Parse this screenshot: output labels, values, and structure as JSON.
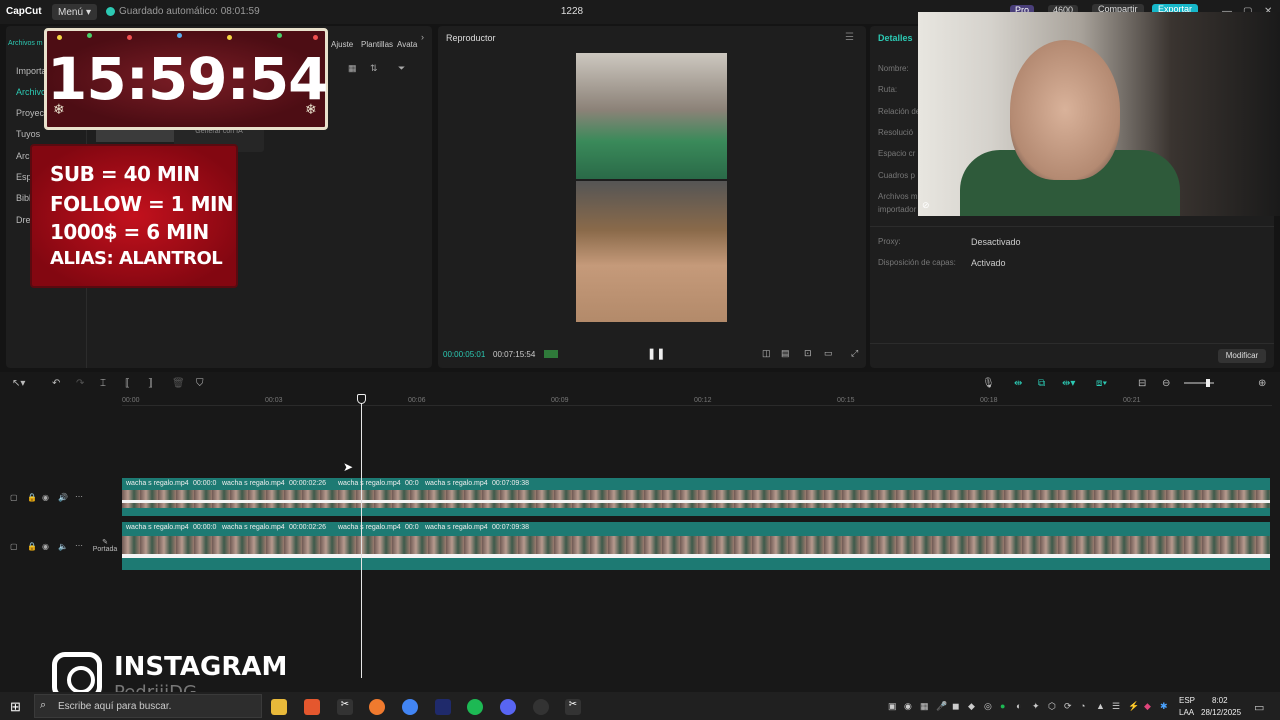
{
  "topbar": {
    "logo": "CapCut",
    "menu_label": "Menú",
    "autosave": "Guardado automático: 08:01:59",
    "project_title": "1228",
    "pro": "Pro",
    "credits": "4600",
    "share": "Compartir",
    "export": "Exportar"
  },
  "media": {
    "top_tab": "Archivos m",
    "sidebar": [
      "Importa",
      "Archivos",
      "Proyect",
      "Tuyos",
      "Arch",
      "Esp",
      "Bibl",
      "Drea"
    ],
    "tools": [
      "Ajuste",
      "Plantillas",
      "Avata"
    ],
    "ai_button": "Generar con IA"
  },
  "overlay": {
    "timer": "15:59:54",
    "rules": [
      "SUB = 40 MIN",
      "FOLLOW = 1 MIN",
      "1000$ = 6 MIN",
      "ALIAS: ALANTROL"
    ],
    "instagram_label": "INSTAGRAM",
    "instagram_user": "PedriiiDG"
  },
  "player": {
    "title": "Reproductor",
    "current_time": "00:00:05:01",
    "total_time": "00:07:15:54"
  },
  "details": {
    "title": "Detalles",
    "labels": [
      "Nombre:",
      "Ruta:",
      "Relación de",
      "Resolució",
      "Espacio cr",
      "Cuadros p",
      "Archivos m",
      "importador",
      "Proxy:",
      "Disposición de capas:"
    ],
    "proxy_value": "Desactivado",
    "layers_value": "Activado",
    "modify": "Modificar"
  },
  "timeline": {
    "ruler": [
      "00:00",
      "00:03",
      "00:06",
      "00:09",
      "00:12",
      "00:15",
      "00:18",
      "00:21"
    ],
    "track1_labels": [
      "wacha s regalo.mp4",
      "00:00:0",
      "wacha s regalo.mp4",
      "00:00:02:26",
      "wacha s regalo.mp4",
      "00:0",
      "wacha s regalo.mp4",
      "00:07:09:38"
    ],
    "track2_labels": [
      "wacha s regalo.mp4",
      "00:00:0",
      "wacha s regalo.mp4",
      "00:00:02:26",
      "wacha s regalo.mp4",
      "00:0",
      "wacha s regalo.mp4",
      "00:07:09:38"
    ],
    "cover_label": "Portada"
  },
  "taskbar": {
    "search_placeholder": "Escribe aquí para buscar.",
    "lang_top": "ESP",
    "lang_bottom": "LAA",
    "time": "8:02",
    "date": "28/12/2025"
  }
}
